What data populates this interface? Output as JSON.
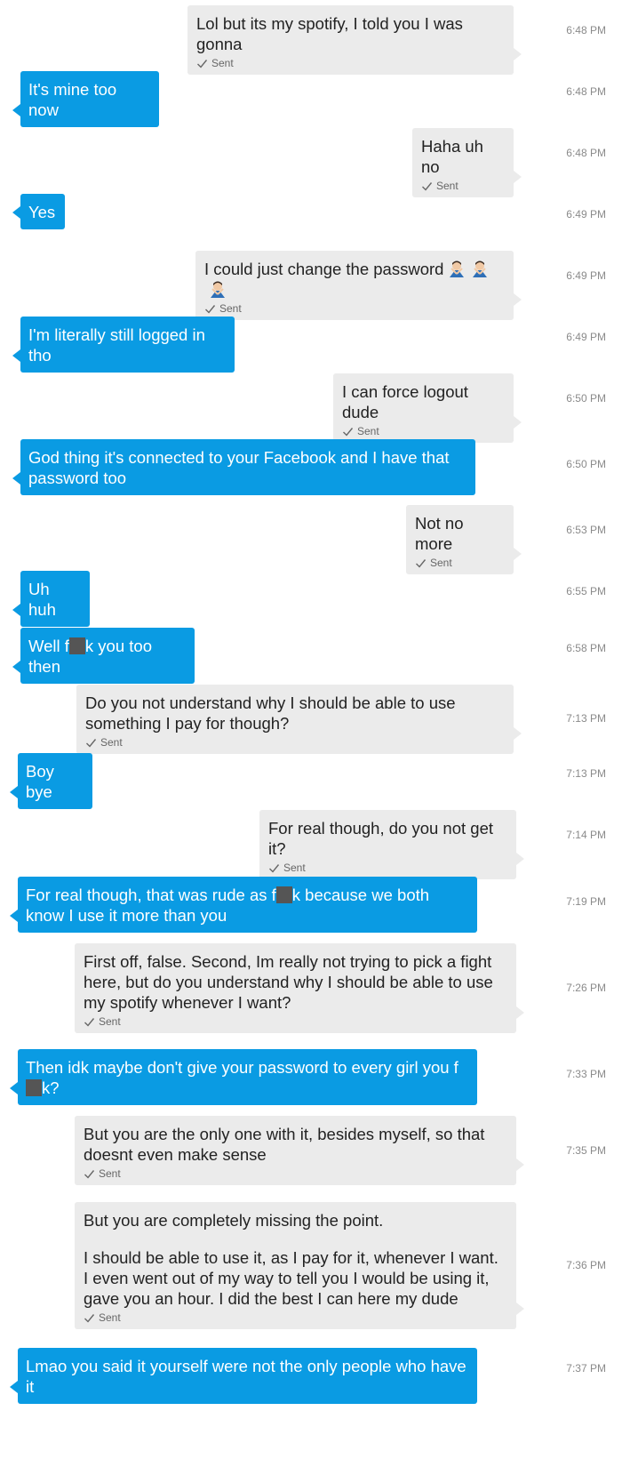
{
  "conversation": {
    "status_label": "Sent",
    "messages": [
      {
        "dir": "out",
        "text": "Lol but its my spotify, I told you I was gonna",
        "time": "6:48 PM"
      },
      {
        "dir": "in",
        "text": "It's mine too now",
        "time": "6:48 PM"
      },
      {
        "dir": "out",
        "text": "Haha uh no",
        "time": "6:48 PM"
      },
      {
        "dir": "in",
        "text": "Yes",
        "time": "6:49 PM"
      },
      {
        "dir": "out",
        "text": "I could just change the password",
        "emoji": "man-gesturing-no-emoji",
        "time": "6:49 PM"
      },
      {
        "dir": "in",
        "text": "I'm literally still logged in tho",
        "time": "6:49 PM"
      },
      {
        "dir": "out",
        "text": "I can force logout dude",
        "time": "6:50 PM"
      },
      {
        "dir": "in",
        "text": "God thing it's connected to your Facebook and I have that password too",
        "time": "6:50 PM"
      },
      {
        "dir": "out",
        "text": "Not no more",
        "time": "6:53 PM"
      },
      {
        "dir": "in",
        "text": "Uh huh",
        "time": "6:55 PM"
      },
      {
        "dir": "in",
        "text_before": "Well f",
        "text_after": "k you too then",
        "time": "6:58 PM"
      },
      {
        "dir": "out",
        "text": "Do you not understand why I should be able to use something I pay for though?",
        "time": "7:13 PM"
      },
      {
        "dir": "in",
        "text": "Boy bye",
        "time": "7:13 PM"
      },
      {
        "dir": "out",
        "text": "For real though, do you not get it?",
        "time": "7:14 PM"
      },
      {
        "dir": "in",
        "text_before": "For real though, that was rude as f",
        "text_after": "k because we both know I use it more than you",
        "time": "7:19 PM"
      },
      {
        "dir": "out",
        "text": "First off, false. Second, Im really not trying to pick a fight here, but do you understand why I should be able to use my spotify whenever I want?",
        "time": "7:26 PM"
      },
      {
        "dir": "in",
        "text_before": "Then idk maybe don't give your password to every girl you f",
        "text_after": "k?",
        "time": "7:33 PM"
      },
      {
        "dir": "out",
        "text": "But you are the only one with it, besides myself, so that doesnt even make sense",
        "time": "7:35 PM"
      },
      {
        "dir": "out",
        "text": "But you are completely missing the point.",
        "text2": "I should be able to use it, as I pay for it, whenever I want. I even went out of my way to tell you I would be using it, gave you an hour. I did the best I can here my dude",
        "time": "7:36 PM"
      },
      {
        "dir": "in",
        "text": "Lmao you said it yourself were not the only people who have it",
        "time": "7:37 PM"
      }
    ]
  },
  "icons": {
    "status": "check-icon",
    "redaction": "redaction-box"
  },
  "colors": {
    "incoming_bubble": "#0a9be3",
    "outgoing_bubble": "#ebebeb",
    "timestamp": "#8a8a8a"
  }
}
